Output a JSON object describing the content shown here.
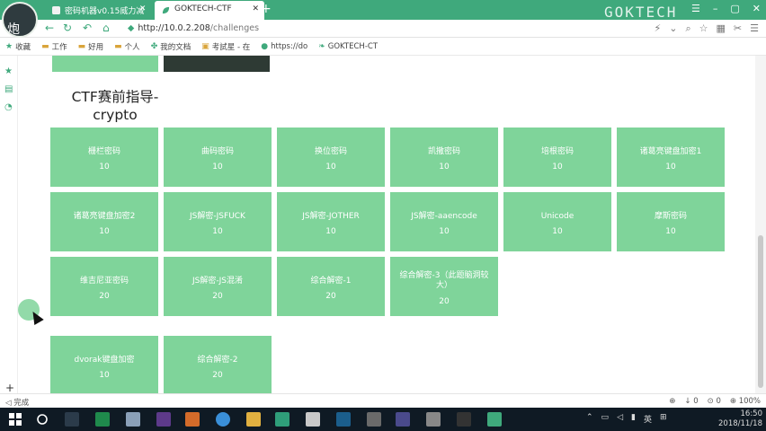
{
  "browser": {
    "avatar_text": "炮",
    "tabs": [
      {
        "label": "密码机器v0.15威力减",
        "active": false
      },
      {
        "label": "GOKTECH-CTF",
        "active": true
      }
    ],
    "new_tab": "+",
    "watermark": "GOKTECH",
    "url_host": "http://10.0.2.208",
    "url_path": "/challenges",
    "bookmarks": [
      "收藏",
      "工作",
      "好用",
      "个人",
      "我的文档",
      "考試星 - 在",
      "https://do",
      "GOKTECH-CT"
    ]
  },
  "page": {
    "heading_line1": "CTF赛前指导-",
    "heading_line2": "crypto",
    "challenges": [
      {
        "name": "栅栏密码",
        "points": "10"
      },
      {
        "name": "曲码密码",
        "points": "10"
      },
      {
        "name": "换位密码",
        "points": "10"
      },
      {
        "name": "凯撒密码",
        "points": "10"
      },
      {
        "name": "培根密码",
        "points": "10"
      },
      {
        "name": "诸葛亮键盘加密1",
        "points": "10"
      },
      {
        "name": "诸葛亮键盘加密2",
        "points": "10"
      },
      {
        "name": "JS解密-JSFUCK",
        "points": "10"
      },
      {
        "name": "JS解密-JOTHER",
        "points": "10"
      },
      {
        "name": "JS解密-aaencode",
        "points": "10"
      },
      {
        "name": "Unicode",
        "points": "10"
      },
      {
        "name": "摩斯密码",
        "points": "10"
      },
      {
        "name": "维吉尼亚密码",
        "points": "20"
      },
      {
        "name": "JS解密-JS混淆",
        "points": "20"
      },
      {
        "name": "综合解密-1",
        "points": "20"
      },
      {
        "name": "综合解密-3（此题脑洞较大）",
        "points": "20"
      },
      {
        "name": "dvorak键盘加密",
        "points": "10"
      },
      {
        "name": "综合解密-2",
        "points": "20"
      }
    ]
  },
  "status": {
    "text": "完成",
    "right_items": [
      "0",
      "0",
      "100%"
    ]
  },
  "taskbar": {
    "time": "16:50",
    "date": "2018/11/18",
    "ime": "英"
  },
  "colors": {
    "accent": "#3fa97c",
    "card": "#7fd49a",
    "taskbar": "#0f1a24"
  }
}
